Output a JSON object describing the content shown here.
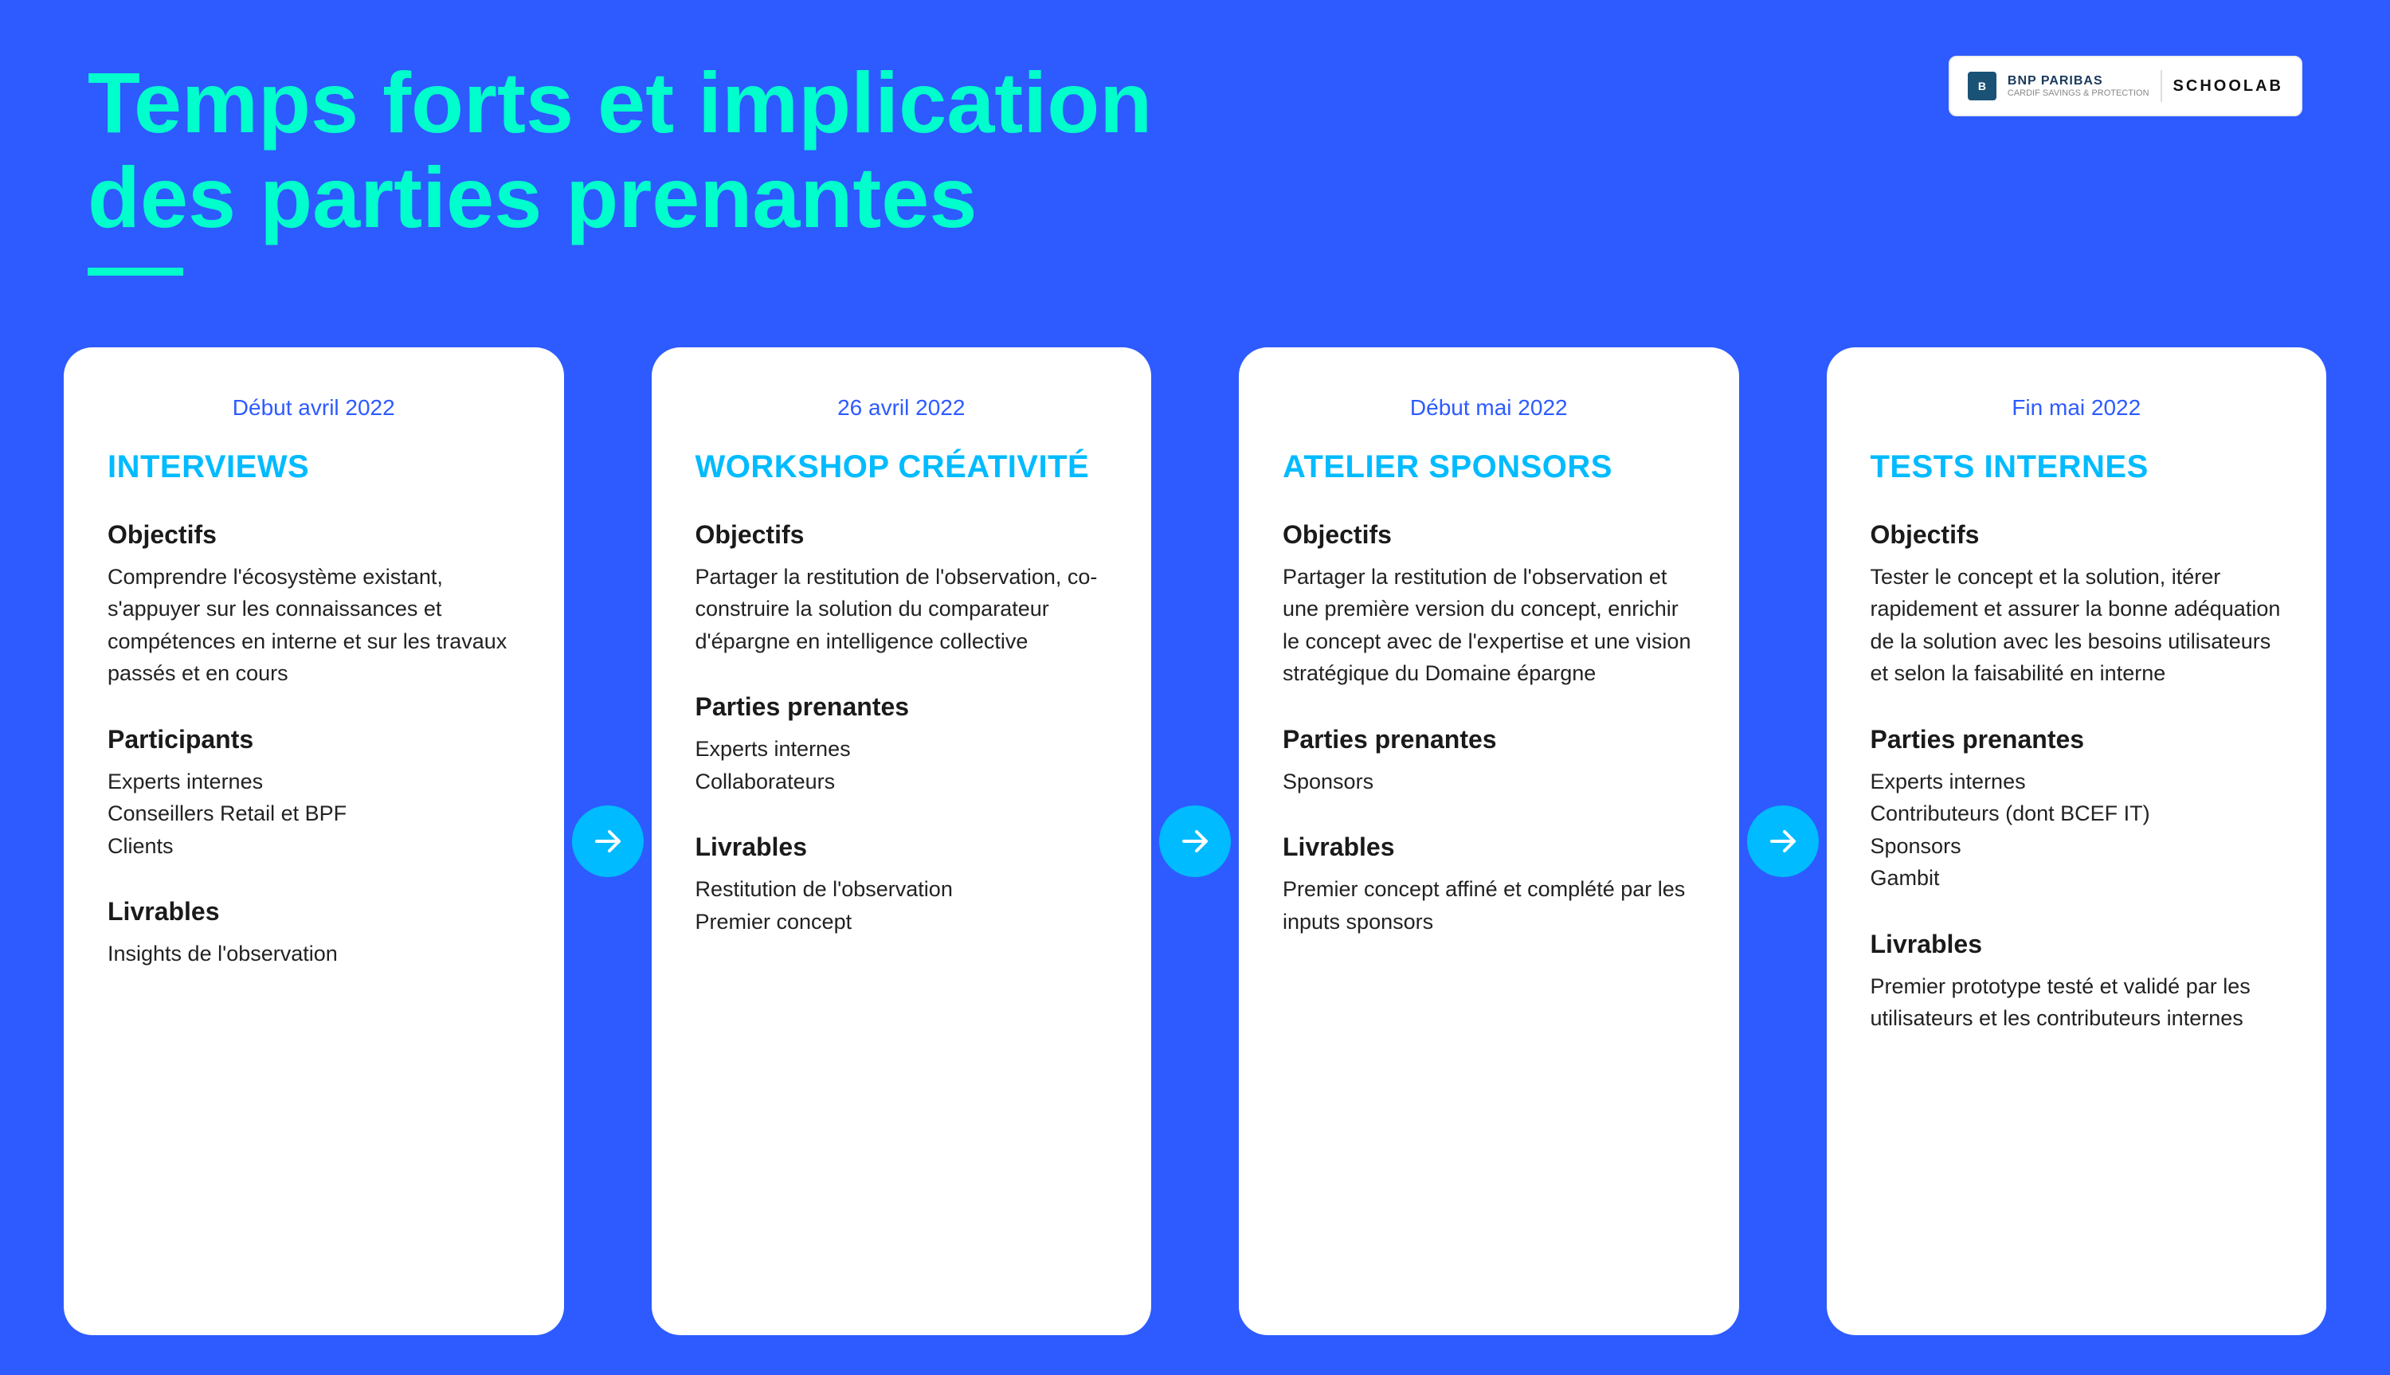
{
  "background_color": "#2D5BFF",
  "header": {
    "title_line1": "Temps forts et implication",
    "title_line2": "des parties prenantes",
    "logo_bnp": "BNP PARIBAS",
    "logo_bnp_sub": "CARDIF SAVINGS & PROTECTION",
    "logo_schoolab": "SCHOOLAB"
  },
  "cards": [
    {
      "date": "Début avril 2022",
      "title": "INTERVIEWS",
      "sections": [
        {
          "heading": "Objectifs",
          "body": "Comprendre l'écosystème existant, s'appuyer sur les connaissances et compétences en interne et sur les travaux passés et en cours"
        },
        {
          "heading": "Participants",
          "body": "Experts internes\nConseillers Retail et BPF\nClients"
        },
        {
          "heading": "Livrables",
          "body": "Insights de l'observation"
        }
      ]
    },
    {
      "date": "26 avril 2022",
      "title": "WORKSHOP CRÉATIVITÉ",
      "sections": [
        {
          "heading": "Objectifs",
          "body": "Partager la restitution de l'observation, co-construire la solution du comparateur d'épargne en intelligence collective"
        },
        {
          "heading": "Parties prenantes",
          "body": "Experts internes\nCollaborateurs"
        },
        {
          "heading": "Livrables",
          "body": "Restitution de l'observation\nPremier concept"
        }
      ]
    },
    {
      "date": "Début mai 2022",
      "title": "ATELIER SPONSORS",
      "sections": [
        {
          "heading": "Objectifs",
          "body": "Partager la restitution de l'observation et une première version du concept, enrichir le concept avec de l'expertise et une vision stratégique du Domaine épargne"
        },
        {
          "heading": "Parties prenantes",
          "body": "Sponsors"
        },
        {
          "heading": "Livrables",
          "body": "Premier concept affiné et complété par les inputs sponsors"
        }
      ]
    },
    {
      "date": "Fin mai 2022",
      "title": "TESTS INTERNES",
      "sections": [
        {
          "heading": "Objectifs",
          "body": "Tester le concept et la solution, itérer rapidement et assurer la bonne adéquation de la solution avec les besoins utilisateurs et selon la faisabilité en interne"
        },
        {
          "heading": "Parties prenantes",
          "body": "Experts internes\nContributeurs (dont BCEF IT)\nSponsors\nGambit"
        },
        {
          "heading": "Livrables",
          "body": "Premier prototype testé et validé par les utilisateurs et les contributeurs internes"
        }
      ]
    }
  ],
  "arrow": {
    "symbol": "→"
  }
}
